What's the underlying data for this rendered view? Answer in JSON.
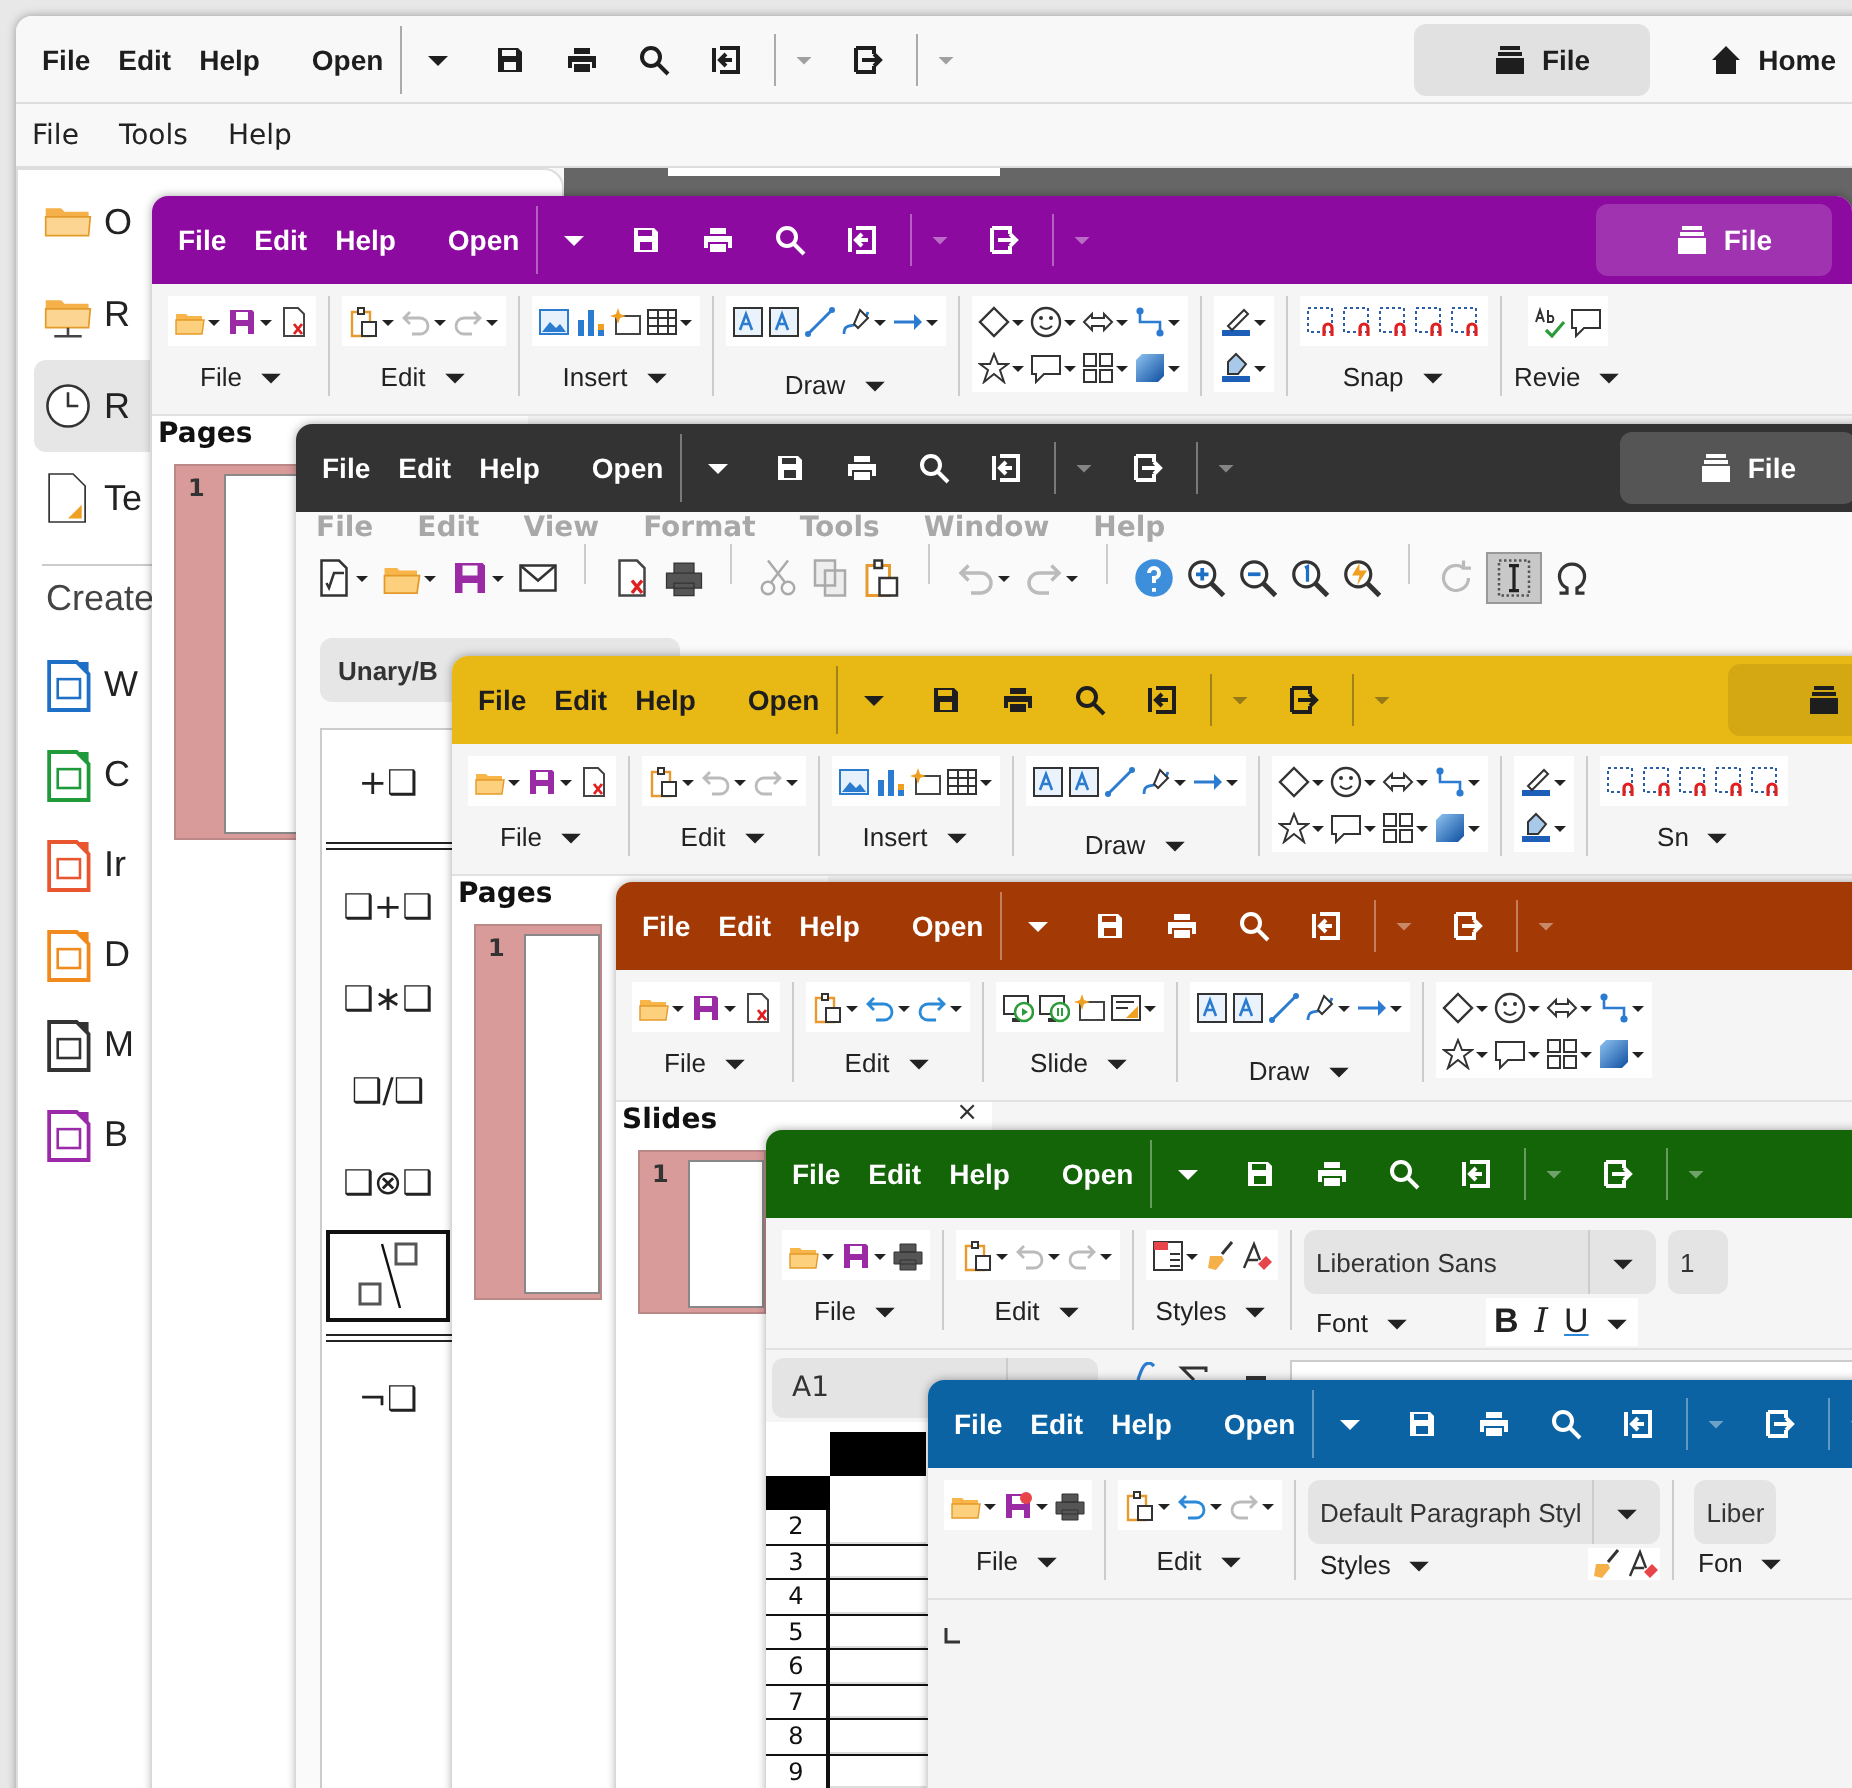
{
  "windows": [
    {
      "kind": "start",
      "color": "#f8f8f8",
      "menu": [
        "File",
        "Edit",
        "Help"
      ],
      "open": "Open",
      "tabs": [
        {
          "label": "File",
          "kind": "file",
          "selected": true
        },
        {
          "label": "Home",
          "kind": "home",
          "selected": false
        }
      ],
      "menubar": [
        "File",
        "Tools",
        "Help"
      ],
      "sidebar": {
        "items": [
          {
            "label": "O",
            "kind": "folder",
            "selected": false
          },
          {
            "label": "R",
            "kind": "remote",
            "selected": false
          },
          {
            "label": "R",
            "kind": "recent",
            "selected": true
          },
          {
            "label": "Te",
            "kind": "templates",
            "selected": false
          }
        ],
        "create_label": "Create",
        "create_items": [
          {
            "label": "W",
            "kind": "writer"
          },
          {
            "label": "C",
            "kind": "calc"
          },
          {
            "label": "Ir",
            "kind": "impress"
          },
          {
            "label": "D",
            "kind": "draw"
          },
          {
            "label": "M",
            "kind": "math"
          },
          {
            "label": "B",
            "kind": "base"
          }
        ]
      }
    },
    {
      "kind": "draw",
      "color": "#8c0aa0",
      "menu": [
        "File",
        "Edit",
        "Help"
      ],
      "open": "Open",
      "tabs": [
        {
          "label": "File",
          "kind": "file",
          "selected": true
        }
      ],
      "groups": [
        {
          "label": "File"
        },
        {
          "label": "Edit"
        },
        {
          "label": "Insert"
        },
        {
          "label": "Draw"
        },
        {
          "label": "Snap"
        },
        {
          "label": "Revie"
        }
      ],
      "panel": {
        "title": "Pages",
        "thumbs": [
          {
            "number": "1",
            "selected": true
          }
        ]
      }
    },
    {
      "kind": "math",
      "color": "#333333",
      "menu": [
        "File",
        "Edit",
        "Help"
      ],
      "open": "Open",
      "tabs": [
        {
          "label": "File",
          "kind": "file",
          "selected": true
        }
      ],
      "ghost_menu": [
        "File",
        "Edit",
        "View",
        "Format",
        "Tools",
        "Window",
        "Help"
      ],
      "elements_tab": "Unary/B",
      "elements": [
        {
          "kind": "symbol",
          "text": "+❑",
          "selected": false
        },
        {
          "kind": "rule"
        },
        {
          "kind": "symbol",
          "text": "❑+❑",
          "selected": false
        },
        {
          "kind": "symbol",
          "text": "❑∗❑",
          "selected": false
        },
        {
          "kind": "symbol",
          "text": "❑/❑",
          "selected": false
        },
        {
          "kind": "symbol",
          "text": "❑⊗❑",
          "selected": false
        },
        {
          "kind": "fraction",
          "selected": true
        },
        {
          "kind": "rule"
        },
        {
          "kind": "symbol",
          "text": "¬❑",
          "selected": false
        }
      ]
    },
    {
      "kind": "draw",
      "color": "#e8b914",
      "menu": [
        "File",
        "Edit",
        "Help"
      ],
      "open": "Open",
      "tabs": [
        {
          "kind": "file",
          "selected": true
        }
      ],
      "groups": [
        {
          "label": "File"
        },
        {
          "label": "Edit"
        },
        {
          "label": "Insert"
        },
        {
          "label": "Draw"
        },
        {
          "label": "Sn"
        }
      ],
      "panel": {
        "title": "Pages",
        "thumbs": [
          {
            "number": "1",
            "selected": true
          }
        ]
      }
    },
    {
      "kind": "impress",
      "color": "#a33a05",
      "menu": [
        "File",
        "Edit",
        "Help"
      ],
      "open": "Open",
      "groups": [
        {
          "label": "File"
        },
        {
          "label": "Edit"
        },
        {
          "label": "Slide"
        },
        {
          "label": "Draw"
        }
      ],
      "panel": {
        "title": "Slides",
        "close": "×",
        "thumbs": [
          {
            "number": "1",
            "selected": true
          }
        ]
      }
    },
    {
      "kind": "calc",
      "color": "#146408",
      "menu": [
        "File",
        "Edit",
        "Help"
      ],
      "open": "Open",
      "groups": [
        {
          "label": "File"
        },
        {
          "label": "Edit"
        },
        {
          "label": "Styles"
        },
        {
          "label": "Font",
          "combos": [
            "Liberation Sans",
            "1"
          ],
          "format_buttons": [
            "B",
            "I",
            "U"
          ]
        }
      ],
      "name_box": "A1",
      "rows": [
        "2",
        "3",
        "4",
        "5",
        "6",
        "7",
        "8",
        "9"
      ]
    },
    {
      "kind": "writer",
      "color": "#0b63a3",
      "menu": [
        "File",
        "Edit",
        "Help"
      ],
      "open": "Open",
      "groups": [
        {
          "label": "File"
        },
        {
          "label": "Edit"
        },
        {
          "label": "Styles",
          "combos": [
            "Default Paragraph Styl"
          ]
        },
        {
          "label": "Fon",
          "combos": [
            "Liber"
          ]
        }
      ]
    }
  ]
}
